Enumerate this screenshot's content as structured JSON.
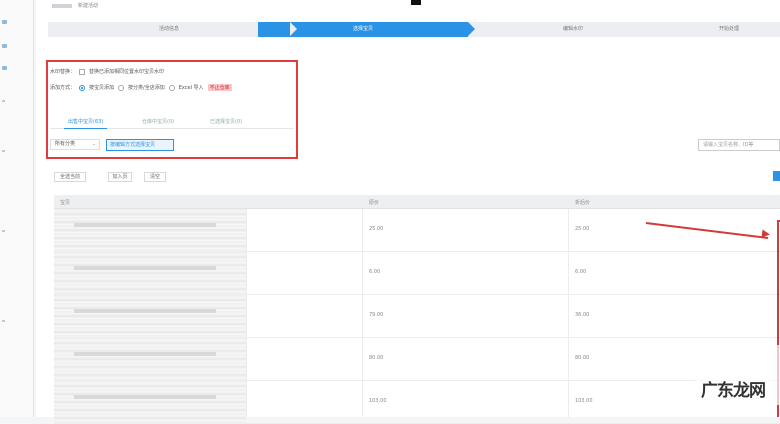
{
  "header": {
    "title": "新建活动"
  },
  "steps": [
    {
      "label": "活动信息",
      "active": false
    },
    {
      "label": "选择宝贝",
      "active": true
    },
    {
      "label": "编辑水印",
      "active": false
    },
    {
      "label": "开始处理",
      "active": false
    }
  ],
  "options": {
    "row1_label": "水印替换：",
    "row1_text": "替换已添加相同位置水印宝贝水印",
    "row2_label": "添加方式：",
    "row2_options": [
      "按宝贝添加",
      "按分类/全店添加",
      "Excel 导入"
    ],
    "row2_tag": "不止仓库"
  },
  "tabs": [
    "出售中宝贝(63)",
    "仓库中宝贝(0)",
    "已选择宝贝(0)"
  ],
  "filters": {
    "select_value": "所有分类",
    "promo_button": "按编辑方式选择宝贝",
    "search_placeholder": "请输入宝贝名称、ID等"
  },
  "actions": [
    "全选当前",
    "加入页",
    "清空"
  ],
  "table": {
    "headers": [
      "宝贝",
      "原价",
      "折后价"
    ],
    "rows": [
      {
        "price": "25.00",
        "sale": "25.00"
      },
      {
        "price": "6.00",
        "sale": "6.00"
      },
      {
        "price": "79.00",
        "sale": "36.00"
      },
      {
        "price": "80.00",
        "sale": "80.00"
      },
      {
        "price": "103.00",
        "sale": "103.00"
      }
    ]
  },
  "watermark": "广东龙网",
  "colors": {
    "accent": "#2a93e5",
    "highlight": "#e23b3b"
  }
}
